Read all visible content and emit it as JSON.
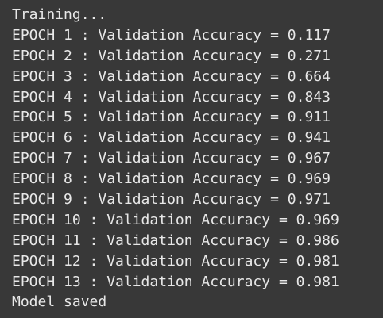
{
  "output": {
    "lines": [
      "Training...",
      "EPOCH 1 : Validation Accuracy = 0.117",
      "EPOCH 2 : Validation Accuracy = 0.271",
      "EPOCH 3 : Validation Accuracy = 0.664",
      "EPOCH 4 : Validation Accuracy = 0.843",
      "EPOCH 5 : Validation Accuracy = 0.911",
      "EPOCH 6 : Validation Accuracy = 0.941",
      "EPOCH 7 : Validation Accuracy = 0.967",
      "EPOCH 8 : Validation Accuracy = 0.969",
      "EPOCH 9 : Validation Accuracy = 0.971",
      "EPOCH 10 : Validation Accuracy = 0.969",
      "EPOCH 11 : Validation Accuracy = 0.986",
      "EPOCH 12 : Validation Accuracy = 0.981",
      "EPOCH 13 : Validation Accuracy = 0.981",
      "Model saved"
    ]
  },
  "colors": {
    "background": "#383838",
    "text": "#e8e8e8"
  }
}
